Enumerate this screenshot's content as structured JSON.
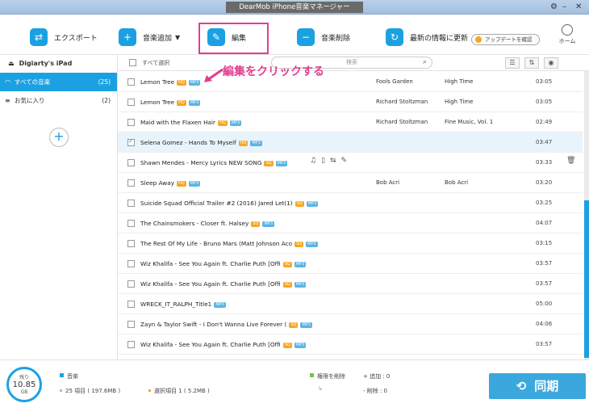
{
  "window": {
    "title": "DearMob iPhone音楽マネージャー"
  },
  "toolbar": {
    "export": "エクスポート",
    "add_music": "音楽追加",
    "edit": "編集",
    "delete_music": "音楽削除",
    "refresh": "最新の情報に更新",
    "update": "アップデートを確認",
    "home": "ホーム"
  },
  "sidebar": {
    "device": "Digiarty's iPad",
    "items": [
      {
        "label": "すべての音楽",
        "count": "(25)"
      },
      {
        "label": "お気に入り",
        "count": "(2)"
      }
    ]
  },
  "list": {
    "select_all": "すべて選択",
    "search_placeholder": "検索",
    "rows": [
      {
        "name": "Lemon Tree",
        "badges": [
          "HQ",
          "MP3"
        ],
        "artist": "Fools Garden",
        "album": "High Time",
        "time": "03:05"
      },
      {
        "name": "Lemon Tree",
        "badges": [
          "HQ",
          "MP3"
        ],
        "artist": "Richard Stoltzman",
        "album": "High Time",
        "time": "03:05"
      },
      {
        "name": "Maid with the Flaxen Hair",
        "badges": [
          "HQ",
          "MP3"
        ],
        "artist": "Richard Stoltzman",
        "album": "Fine Music, Vol. 1",
        "time": "02:49"
      },
      {
        "name": "Selena Gomez - Hands To Myself",
        "badges": [
          "HQ",
          "MP3"
        ],
        "artist": "",
        "album": "",
        "time": "03:47"
      },
      {
        "name": "Shawn Mendes - Mercy Lyrics NEW SONG",
        "badges": [
          "SQ",
          "MP3"
        ],
        "artist": "",
        "album": "",
        "time": "03:33"
      },
      {
        "name": "Sleep Away",
        "badges": [
          "HQ",
          "MP3"
        ],
        "artist": "Bob Acri",
        "album": "Bob Acri",
        "time": "03:20"
      },
      {
        "name": "Suicide Squad Official Trailer #2 (2016) Jared Let(1)",
        "badges": [
          "SQ",
          "MP3"
        ],
        "artist": "",
        "album": "",
        "time": "03:25"
      },
      {
        "name": "The Chainsmokers - Closer ft. Halsey",
        "badges": [
          "SQ",
          "MP3"
        ],
        "artist": "",
        "album": "",
        "time": "04:07"
      },
      {
        "name": "The Rest Of My Life - Bruno Mars (Matt Johnson Aco",
        "badges": [
          "SQ",
          "MP3"
        ],
        "artist": "",
        "album": "",
        "time": "03:15"
      },
      {
        "name": "Wiz Khalifa - See You Again ft. Charlie Puth [Offi",
        "badges": [
          "SQ",
          "MP3"
        ],
        "artist": "",
        "album": "",
        "time": "03:57"
      },
      {
        "name": "Wiz Khalifa - See You Again ft. Charlie Puth [Offi",
        "badges": [
          "SQ",
          "MP3"
        ],
        "artist": "",
        "album": "",
        "time": "03:57"
      },
      {
        "name": "WRECK_IT_RALPH_Title1",
        "badges": [
          "MP3"
        ],
        "artist": "",
        "album": "",
        "time": "05:00"
      },
      {
        "name": "Zayn & Taylor Swift - I Don't Wanna Live Forever (",
        "badges": [
          "SQ",
          "MP3"
        ],
        "artist": "",
        "album": "",
        "time": "04:06"
      },
      {
        "name": "Wiz Khalifa - See You Again ft. Charlie Puth [Offi",
        "badges": [
          "SQ",
          "MP3"
        ],
        "artist": "",
        "album": "",
        "time": "03:57"
      }
    ]
  },
  "callout": {
    "text": "編集をクリックする"
  },
  "footer": {
    "cap_top": "残り",
    "cap_value": "10.85",
    "cap_unit": "GB",
    "music_label": "音楽",
    "summary_items": "25 項目 ( 197.6MB )",
    "summary_selected": "選択項目 1 ( 5.2MB )",
    "delete_label": "権限を削除",
    "add_count": "+ 追加 : 0",
    "del_count": "- 削除 : 0",
    "sync": "同期"
  },
  "colors": {
    "accent": "#1ba1e2",
    "highlight": "#e33d8f",
    "hq": "#f6a623",
    "sq": "#f6a623",
    "mp3": "#5ab4e5"
  }
}
